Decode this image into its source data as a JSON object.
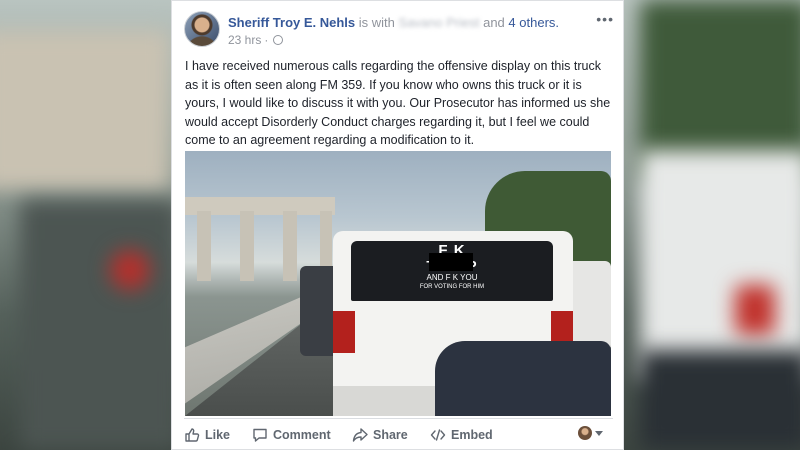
{
  "post": {
    "author_name": "Sheriff Troy E. Nehls",
    "with_prefix": "is with",
    "tagged_person": "Savano Priest",
    "and_text": "and",
    "others_link": "4 others.",
    "timestamp": "23 hrs",
    "meta_separator": "·",
    "privacy_icon": "globe-icon",
    "more_icon": "ellipsis-icon",
    "text": "I have received numerous calls regarding the offensive display on this truck as it is often seen along FM 359. If you know who owns this truck or it is yours, I would like to discuss it with you. Our Prosecutor has informed us she would accept Disorderly Conduct charges regarding it, but I feel we could come to an agreement regarding a modification to it."
  },
  "photo": {
    "sticker_line1": "F  K",
    "sticker_line2": "TRUMP",
    "sticker_line3": "AND F  K YOU",
    "sticker_line4": "FOR VOTING FOR HIM"
  },
  "actions": {
    "like": "Like",
    "comment": "Comment",
    "share": "Share",
    "embed": "Embed"
  },
  "colors": {
    "link": "#365899",
    "text": "#1d2129",
    "muted": "#90949c",
    "action": "#606770"
  }
}
